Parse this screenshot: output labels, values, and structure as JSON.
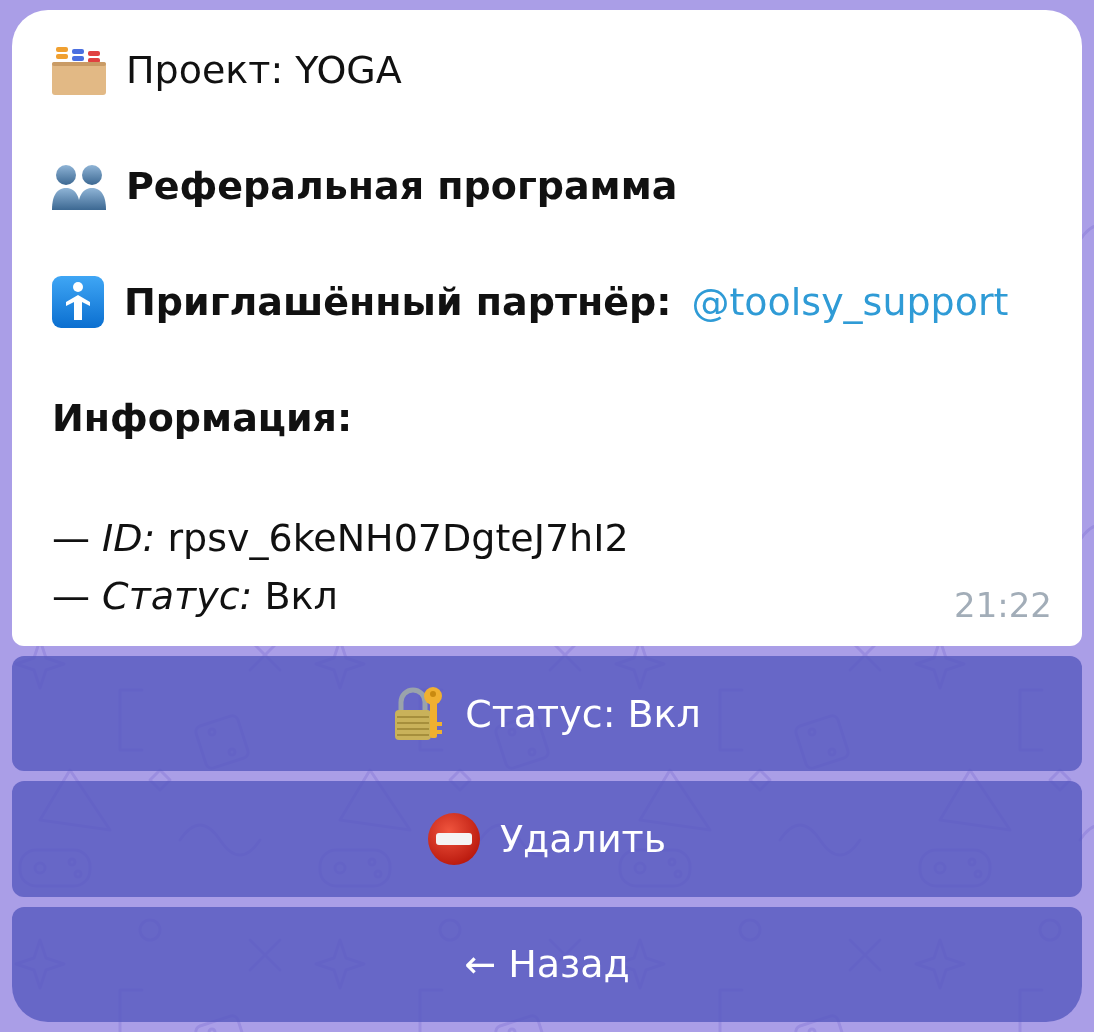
{
  "message": {
    "project": "Проект: YOGA",
    "section_title": "Реферальная программа",
    "partner": {
      "label": "Приглашённый партнёр:",
      "link": "@toolsy_support"
    },
    "info_title": "Информация:",
    "info_lines": [
      "— *ID:* rpsv_6keNH07DgteJ7hI2",
      "— *Статус:* Вкл"
    ],
    "time": "21:22"
  },
  "buttons": [
    {
      "kind": "status",
      "label": "Статус: Вкл"
    },
    {
      "kind": "delete",
      "label": "Удалить"
    },
    {
      "kind": "back",
      "label": "← Назад"
    }
  ]
}
